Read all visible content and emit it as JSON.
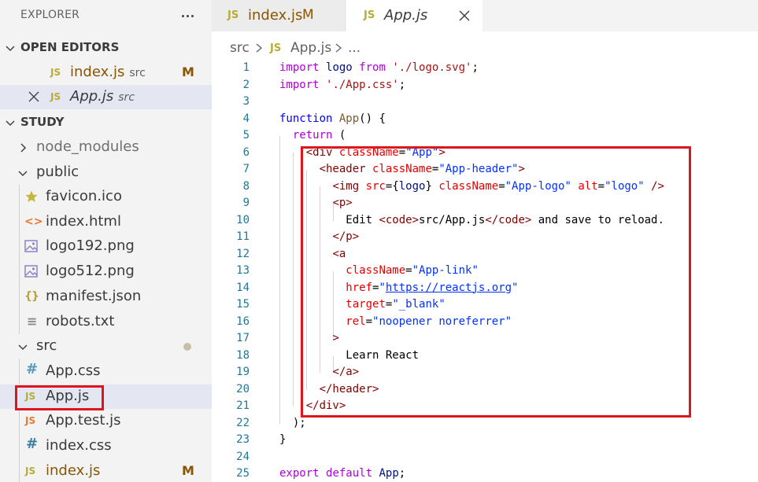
{
  "explorer": {
    "title": "EXPLORER",
    "more_actions": "..."
  },
  "open_editors": {
    "title": "OPEN EDITORS",
    "items": [
      {
        "name": "index.js",
        "icon": "JS",
        "description": "src",
        "badge": "M"
      },
      {
        "name": "App.js",
        "icon": "JS",
        "description": "src",
        "badge": ""
      }
    ]
  },
  "folder": {
    "title": "STUDY",
    "items": [
      {
        "name": "node_modules",
        "icon": "chevron-right"
      },
      {
        "name": "public",
        "icon": "chevron-down"
      },
      {
        "name": "favicon.ico",
        "icon": "★"
      },
      {
        "name": "index.html",
        "icon": "<>"
      },
      {
        "name": "logo192.png",
        "icon": "image"
      },
      {
        "name": "logo512.png",
        "icon": "image"
      },
      {
        "name": "manifest.json",
        "icon": "{}"
      },
      {
        "name": "robots.txt",
        "icon": "≡"
      },
      {
        "name": "src",
        "icon": "chevron-down"
      },
      {
        "name": "App.css",
        "icon": "#"
      },
      {
        "name": "App.js",
        "icon": "JS"
      },
      {
        "name": "App.test.js",
        "icon": "JS"
      },
      {
        "name": "index.css",
        "icon": "#"
      },
      {
        "name": "index.js",
        "icon": "JS",
        "badge": "M"
      }
    ]
  },
  "tabs": [
    {
      "label": "index.js",
      "icon": "JS",
      "badge": "M"
    },
    {
      "label": "App.js",
      "icon": "JS",
      "close": "✕"
    }
  ],
  "breadcrumb": {
    "folder": "src",
    "file_icon": "JS",
    "file": "App.js",
    "trailing": "..."
  },
  "code": {
    "line_numbers": [
      "1",
      "2",
      "3",
      "4",
      "5",
      "6",
      "7",
      "8",
      "9",
      "10",
      "11",
      "12",
      "13",
      "14",
      "15",
      "16",
      "17",
      "18",
      "19",
      "20",
      "21",
      "22",
      "23",
      "24",
      "25"
    ]
  },
  "colors": {
    "highlight_box": "#e0141c",
    "modified_badge": "#895503",
    "selected_row": "#e4e6f1"
  }
}
